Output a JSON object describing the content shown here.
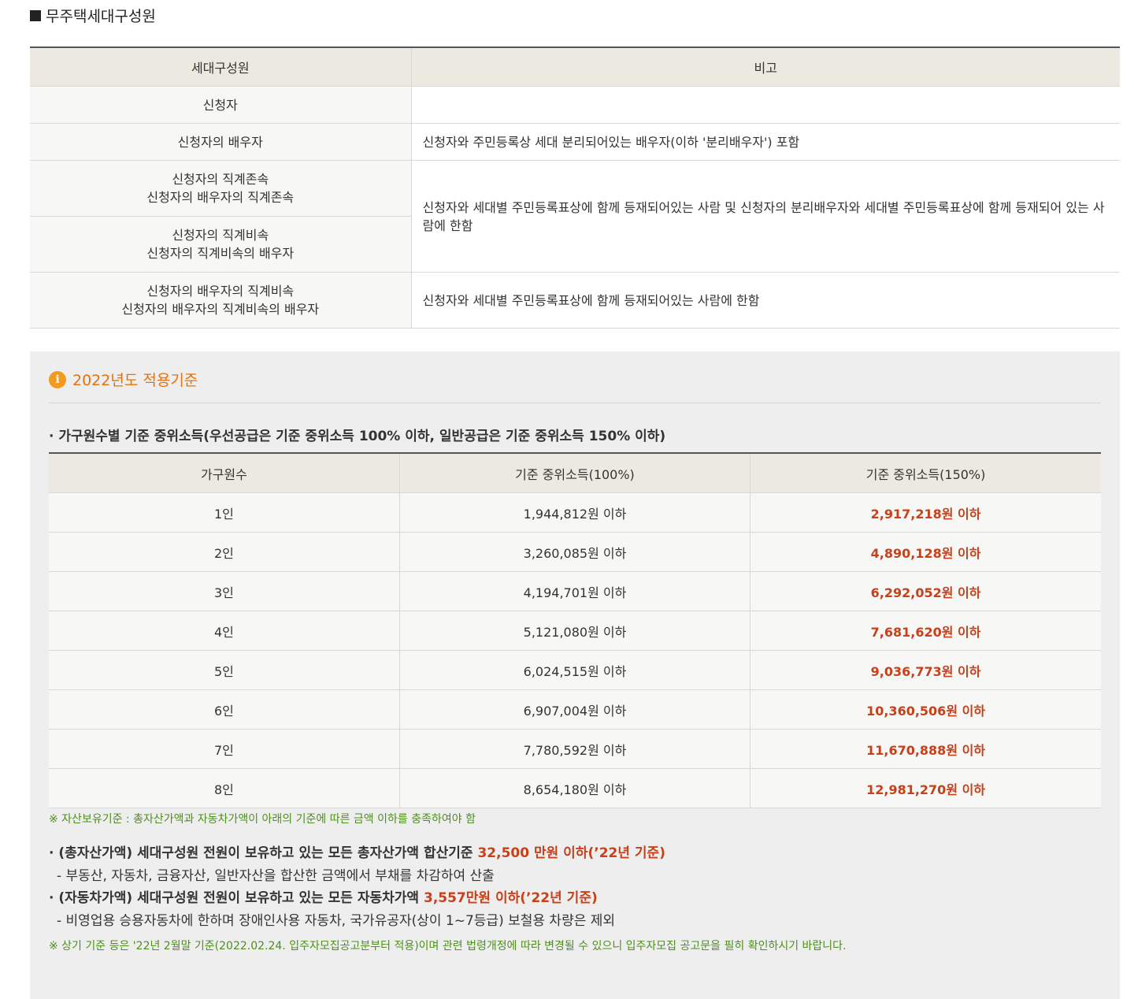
{
  "section_title": "무주택세대구성원",
  "members_table": {
    "headers": [
      "세대구성원",
      "비고"
    ],
    "rows": [
      {
        "member_lines": [
          "신청자"
        ],
        "note": ""
      },
      {
        "member_lines": [
          "신청자의 배우자"
        ],
        "note": "신청자와 주민등록상 세대 분리되어있는 배우자(이하 '분리배우자') 포함"
      },
      {
        "member_lines": [
          "신청자의 직계존속",
          "신청자의 배우자의 직계존속"
        ],
        "note": "신청자와 세대별 주민등록표상에 함께 등재되어있는 사람 및 신청자의 분리배우자와 세대별 주민등록표상에 함께 등재되어 있는 사람에 한함"
      },
      {
        "member_lines": [
          "신청자의 직계비속",
          "신청자의 직계비속의 배우자"
        ],
        "note": ""
      },
      {
        "member_lines": [
          "신청자의 배우자의 직계비속",
          "신청자의 배우자의 직계비속의 배우자"
        ],
        "note": "신청자와 세대별 주민등록표상에 함께 등재되어있는 사람에 한함"
      }
    ]
  },
  "info": {
    "title": "2022년도 적용기준",
    "income_heading": "· 가구원수별 기준 중위소득(우선공급은 기준 중위소득 100% 이하, 일반공급은 기준 중위소득 150% 이하)",
    "income_table": {
      "headers": [
        "가구원수",
        "기준 중위소득(100%)",
        "기준 중위소득(150%)"
      ],
      "rows": [
        [
          "1인",
          "1,944,812원 이하",
          "2,917,218원 이하"
        ],
        [
          "2인",
          "3,260,085원 이하",
          "4,890,128원 이하"
        ],
        [
          "3인",
          "4,194,701원 이하",
          "6,292,052원 이하"
        ],
        [
          "4인",
          "5,121,080원 이하",
          "7,681,620원 이하"
        ],
        [
          "5인",
          "6,024,515원 이하",
          "9,036,773원 이하"
        ],
        [
          "6인",
          "6,907,004원 이하",
          "10,360,506원 이하"
        ],
        [
          "7인",
          "7,780,592원 이하",
          "11,670,888원 이하"
        ],
        [
          "8인",
          "8,654,180원 이하",
          "12,981,270원 이하"
        ]
      ]
    },
    "asset_note": "※ 자산보유기준 : 총자산가액과 자동차가액이 아래의 기준에 따른 금액 이하를 충족하여야 함",
    "total_asset_text": "· (총자산가액) 세대구성원 전원이 보유하고 있는 모든 총자산가액 합산기준 ",
    "total_asset_value": "32,500 만원 이하(’22년 기준)",
    "total_asset_sub": "- 부동산, 자동차, 금융자산, 일반자산을 합산한 금액에서 부채를 차감하여 산출",
    "car_text": "· (자동차가액) 세대구성원 전원이 보유하고 있는 모든 자동차가액 ",
    "car_value": "3,557만원 이하(’22년 기준)",
    "car_sub": "- 비영업용 승용자동차에 한하며 장애인사용 자동차, 국가유공자(상이 1~7등급) 보철용 차량은 제외",
    "footer_note": "※ 상기 기준 등은 '22년 2월말 기준(2022.02.24. 입주자모집공고분부터 적용)이며 관련 법령개정에 따라 변경될 수 있으니 입주자모집 공고문을 필히 확인하시기 바랍니다."
  },
  "colors": {
    "header_bg": "#ece9e0",
    "highlight_red": "#c8401a",
    "info_orange": "#e2720f",
    "note_green": "#4e8f1c"
  }
}
